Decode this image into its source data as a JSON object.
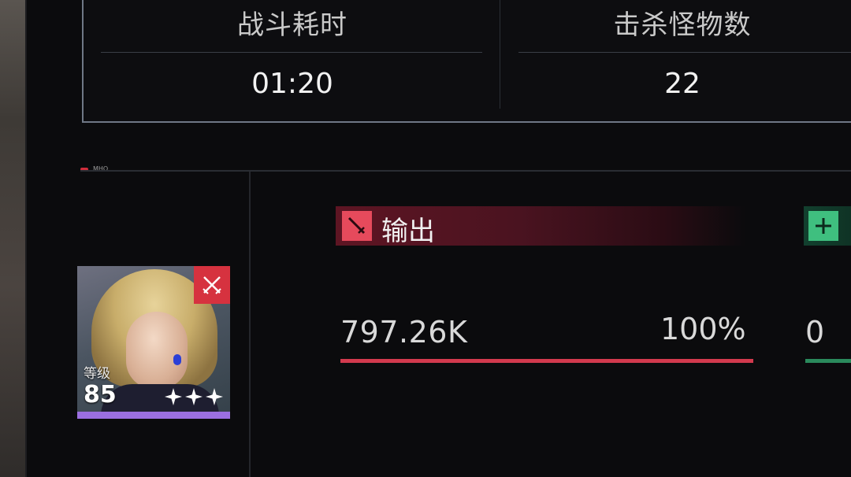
{
  "stats": {
    "duration_label": "战斗耗时",
    "duration_value": "01:20",
    "kills_label": "击杀怪物数",
    "kills_value": "22"
  },
  "section": {
    "marker_text": "MHO"
  },
  "character": {
    "level_label": "等级",
    "level": "85",
    "stars": 3,
    "role_icon": "crossed-swords-icon",
    "rarity_color": "#9b6fe0"
  },
  "output": {
    "label": "输出",
    "value": "797.26K",
    "percent": "100%",
    "share": 1.0,
    "icon": "sword-icon",
    "color": "#d33a4e"
  },
  "support": {
    "value": "0",
    "icon": "plus-icon",
    "color": "#3fbf7f"
  }
}
